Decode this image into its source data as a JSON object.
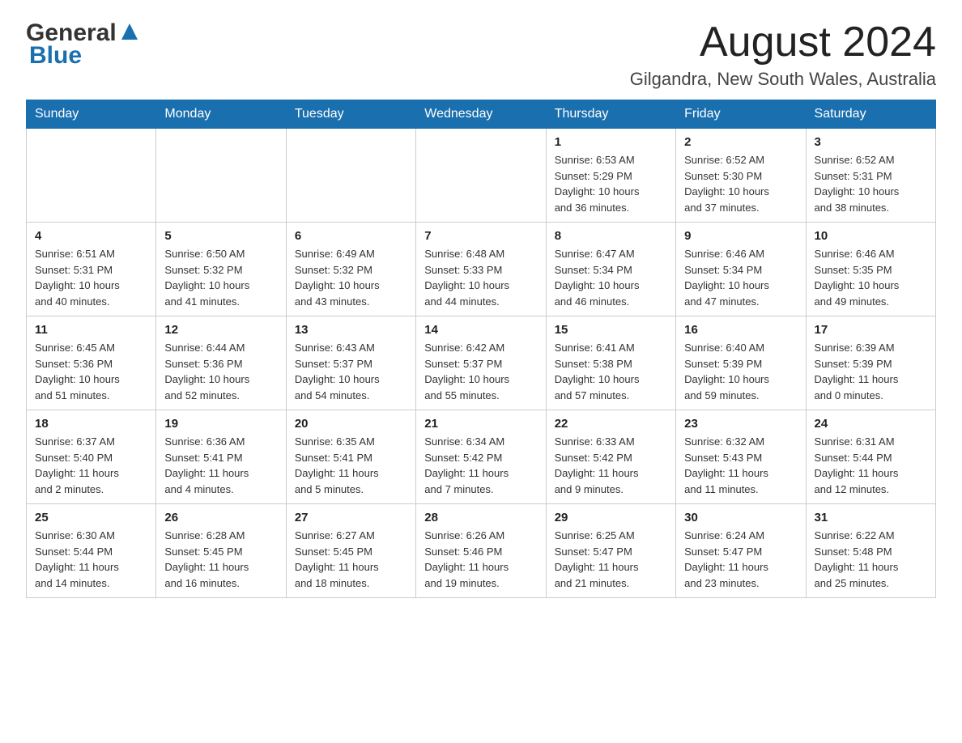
{
  "header": {
    "logo_general": "General",
    "logo_blue": "Blue",
    "month_year": "August 2024",
    "location": "Gilgandra, New South Wales, Australia"
  },
  "days_of_week": [
    "Sunday",
    "Monday",
    "Tuesday",
    "Wednesday",
    "Thursday",
    "Friday",
    "Saturday"
  ],
  "weeks": [
    [
      {
        "day": "",
        "info": ""
      },
      {
        "day": "",
        "info": ""
      },
      {
        "day": "",
        "info": ""
      },
      {
        "day": "",
        "info": ""
      },
      {
        "day": "1",
        "info": "Sunrise: 6:53 AM\nSunset: 5:29 PM\nDaylight: 10 hours\nand 36 minutes."
      },
      {
        "day": "2",
        "info": "Sunrise: 6:52 AM\nSunset: 5:30 PM\nDaylight: 10 hours\nand 37 minutes."
      },
      {
        "day": "3",
        "info": "Sunrise: 6:52 AM\nSunset: 5:31 PM\nDaylight: 10 hours\nand 38 minutes."
      }
    ],
    [
      {
        "day": "4",
        "info": "Sunrise: 6:51 AM\nSunset: 5:31 PM\nDaylight: 10 hours\nand 40 minutes."
      },
      {
        "day": "5",
        "info": "Sunrise: 6:50 AM\nSunset: 5:32 PM\nDaylight: 10 hours\nand 41 minutes."
      },
      {
        "day": "6",
        "info": "Sunrise: 6:49 AM\nSunset: 5:32 PM\nDaylight: 10 hours\nand 43 minutes."
      },
      {
        "day": "7",
        "info": "Sunrise: 6:48 AM\nSunset: 5:33 PM\nDaylight: 10 hours\nand 44 minutes."
      },
      {
        "day": "8",
        "info": "Sunrise: 6:47 AM\nSunset: 5:34 PM\nDaylight: 10 hours\nand 46 minutes."
      },
      {
        "day": "9",
        "info": "Sunrise: 6:46 AM\nSunset: 5:34 PM\nDaylight: 10 hours\nand 47 minutes."
      },
      {
        "day": "10",
        "info": "Sunrise: 6:46 AM\nSunset: 5:35 PM\nDaylight: 10 hours\nand 49 minutes."
      }
    ],
    [
      {
        "day": "11",
        "info": "Sunrise: 6:45 AM\nSunset: 5:36 PM\nDaylight: 10 hours\nand 51 minutes."
      },
      {
        "day": "12",
        "info": "Sunrise: 6:44 AM\nSunset: 5:36 PM\nDaylight: 10 hours\nand 52 minutes."
      },
      {
        "day": "13",
        "info": "Sunrise: 6:43 AM\nSunset: 5:37 PM\nDaylight: 10 hours\nand 54 minutes."
      },
      {
        "day": "14",
        "info": "Sunrise: 6:42 AM\nSunset: 5:37 PM\nDaylight: 10 hours\nand 55 minutes."
      },
      {
        "day": "15",
        "info": "Sunrise: 6:41 AM\nSunset: 5:38 PM\nDaylight: 10 hours\nand 57 minutes."
      },
      {
        "day": "16",
        "info": "Sunrise: 6:40 AM\nSunset: 5:39 PM\nDaylight: 10 hours\nand 59 minutes."
      },
      {
        "day": "17",
        "info": "Sunrise: 6:39 AM\nSunset: 5:39 PM\nDaylight: 11 hours\nand 0 minutes."
      }
    ],
    [
      {
        "day": "18",
        "info": "Sunrise: 6:37 AM\nSunset: 5:40 PM\nDaylight: 11 hours\nand 2 minutes."
      },
      {
        "day": "19",
        "info": "Sunrise: 6:36 AM\nSunset: 5:41 PM\nDaylight: 11 hours\nand 4 minutes."
      },
      {
        "day": "20",
        "info": "Sunrise: 6:35 AM\nSunset: 5:41 PM\nDaylight: 11 hours\nand 5 minutes."
      },
      {
        "day": "21",
        "info": "Sunrise: 6:34 AM\nSunset: 5:42 PM\nDaylight: 11 hours\nand 7 minutes."
      },
      {
        "day": "22",
        "info": "Sunrise: 6:33 AM\nSunset: 5:42 PM\nDaylight: 11 hours\nand 9 minutes."
      },
      {
        "day": "23",
        "info": "Sunrise: 6:32 AM\nSunset: 5:43 PM\nDaylight: 11 hours\nand 11 minutes."
      },
      {
        "day": "24",
        "info": "Sunrise: 6:31 AM\nSunset: 5:44 PM\nDaylight: 11 hours\nand 12 minutes."
      }
    ],
    [
      {
        "day": "25",
        "info": "Sunrise: 6:30 AM\nSunset: 5:44 PM\nDaylight: 11 hours\nand 14 minutes."
      },
      {
        "day": "26",
        "info": "Sunrise: 6:28 AM\nSunset: 5:45 PM\nDaylight: 11 hours\nand 16 minutes."
      },
      {
        "day": "27",
        "info": "Sunrise: 6:27 AM\nSunset: 5:45 PM\nDaylight: 11 hours\nand 18 minutes."
      },
      {
        "day": "28",
        "info": "Sunrise: 6:26 AM\nSunset: 5:46 PM\nDaylight: 11 hours\nand 19 minutes."
      },
      {
        "day": "29",
        "info": "Sunrise: 6:25 AM\nSunset: 5:47 PM\nDaylight: 11 hours\nand 21 minutes."
      },
      {
        "day": "30",
        "info": "Sunrise: 6:24 AM\nSunset: 5:47 PM\nDaylight: 11 hours\nand 23 minutes."
      },
      {
        "day": "31",
        "info": "Sunrise: 6:22 AM\nSunset: 5:48 PM\nDaylight: 11 hours\nand 25 minutes."
      }
    ]
  ]
}
